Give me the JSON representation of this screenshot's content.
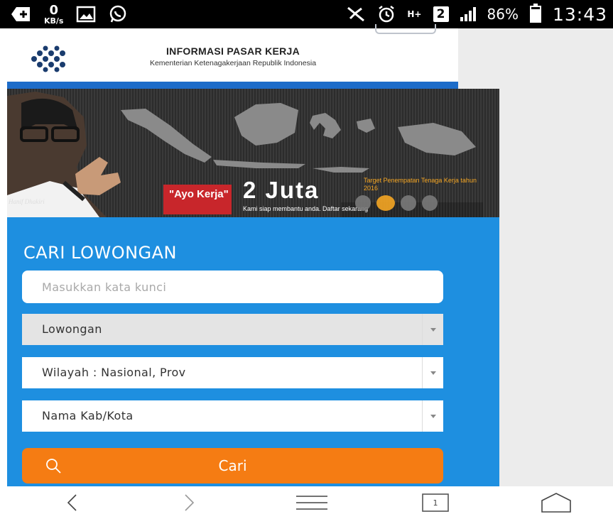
{
  "status_bar": {
    "speed_value": "0",
    "speed_unit": "KB/s",
    "network": "H+",
    "sim_slot": "2",
    "battery_pct": "86%",
    "battery_level": 0.86,
    "time": "13:43",
    "icons": [
      "plus-box-icon",
      "image-icon",
      "whatsapp-icon",
      "mute-icon",
      "alarm-icon",
      "signal-icon",
      "battery-icon"
    ]
  },
  "header": {
    "title": "INFORMASI PASAR KERJA",
    "subtitle": "Kementerian Ketenagakerjaan Republik Indonesia"
  },
  "banner": {
    "slogan": "\"Ayo Kerja\"",
    "headline": "2 Juta",
    "target_text": "Target Penempatan Tenaga Kerja tahun 2016",
    "tagline": "Kami siap membantu anda. Daftar sekarang",
    "credit": "Hanif Dhakiri",
    "slide_count": 4,
    "active_slide": 1,
    "colors": {
      "slogan_bg": "#c8262b",
      "accent": "#f5a623"
    }
  },
  "search": {
    "title": "CARI LOWONGAN",
    "keyword_placeholder": "Masukkan kata kunci",
    "type_select": "Lowongan",
    "region_select": "Wilayah : Nasional, Prov",
    "city_select": "Nama Kab/Kota",
    "submit_label": "Cari",
    "colors": {
      "panel": "#1e8fe0",
      "button": "#f57c13"
    }
  },
  "bottom_nav": {
    "tab_count": "1",
    "icons": [
      "back-icon",
      "forward-icon",
      "menu-icon",
      "tabs-icon",
      "home-icon"
    ]
  }
}
